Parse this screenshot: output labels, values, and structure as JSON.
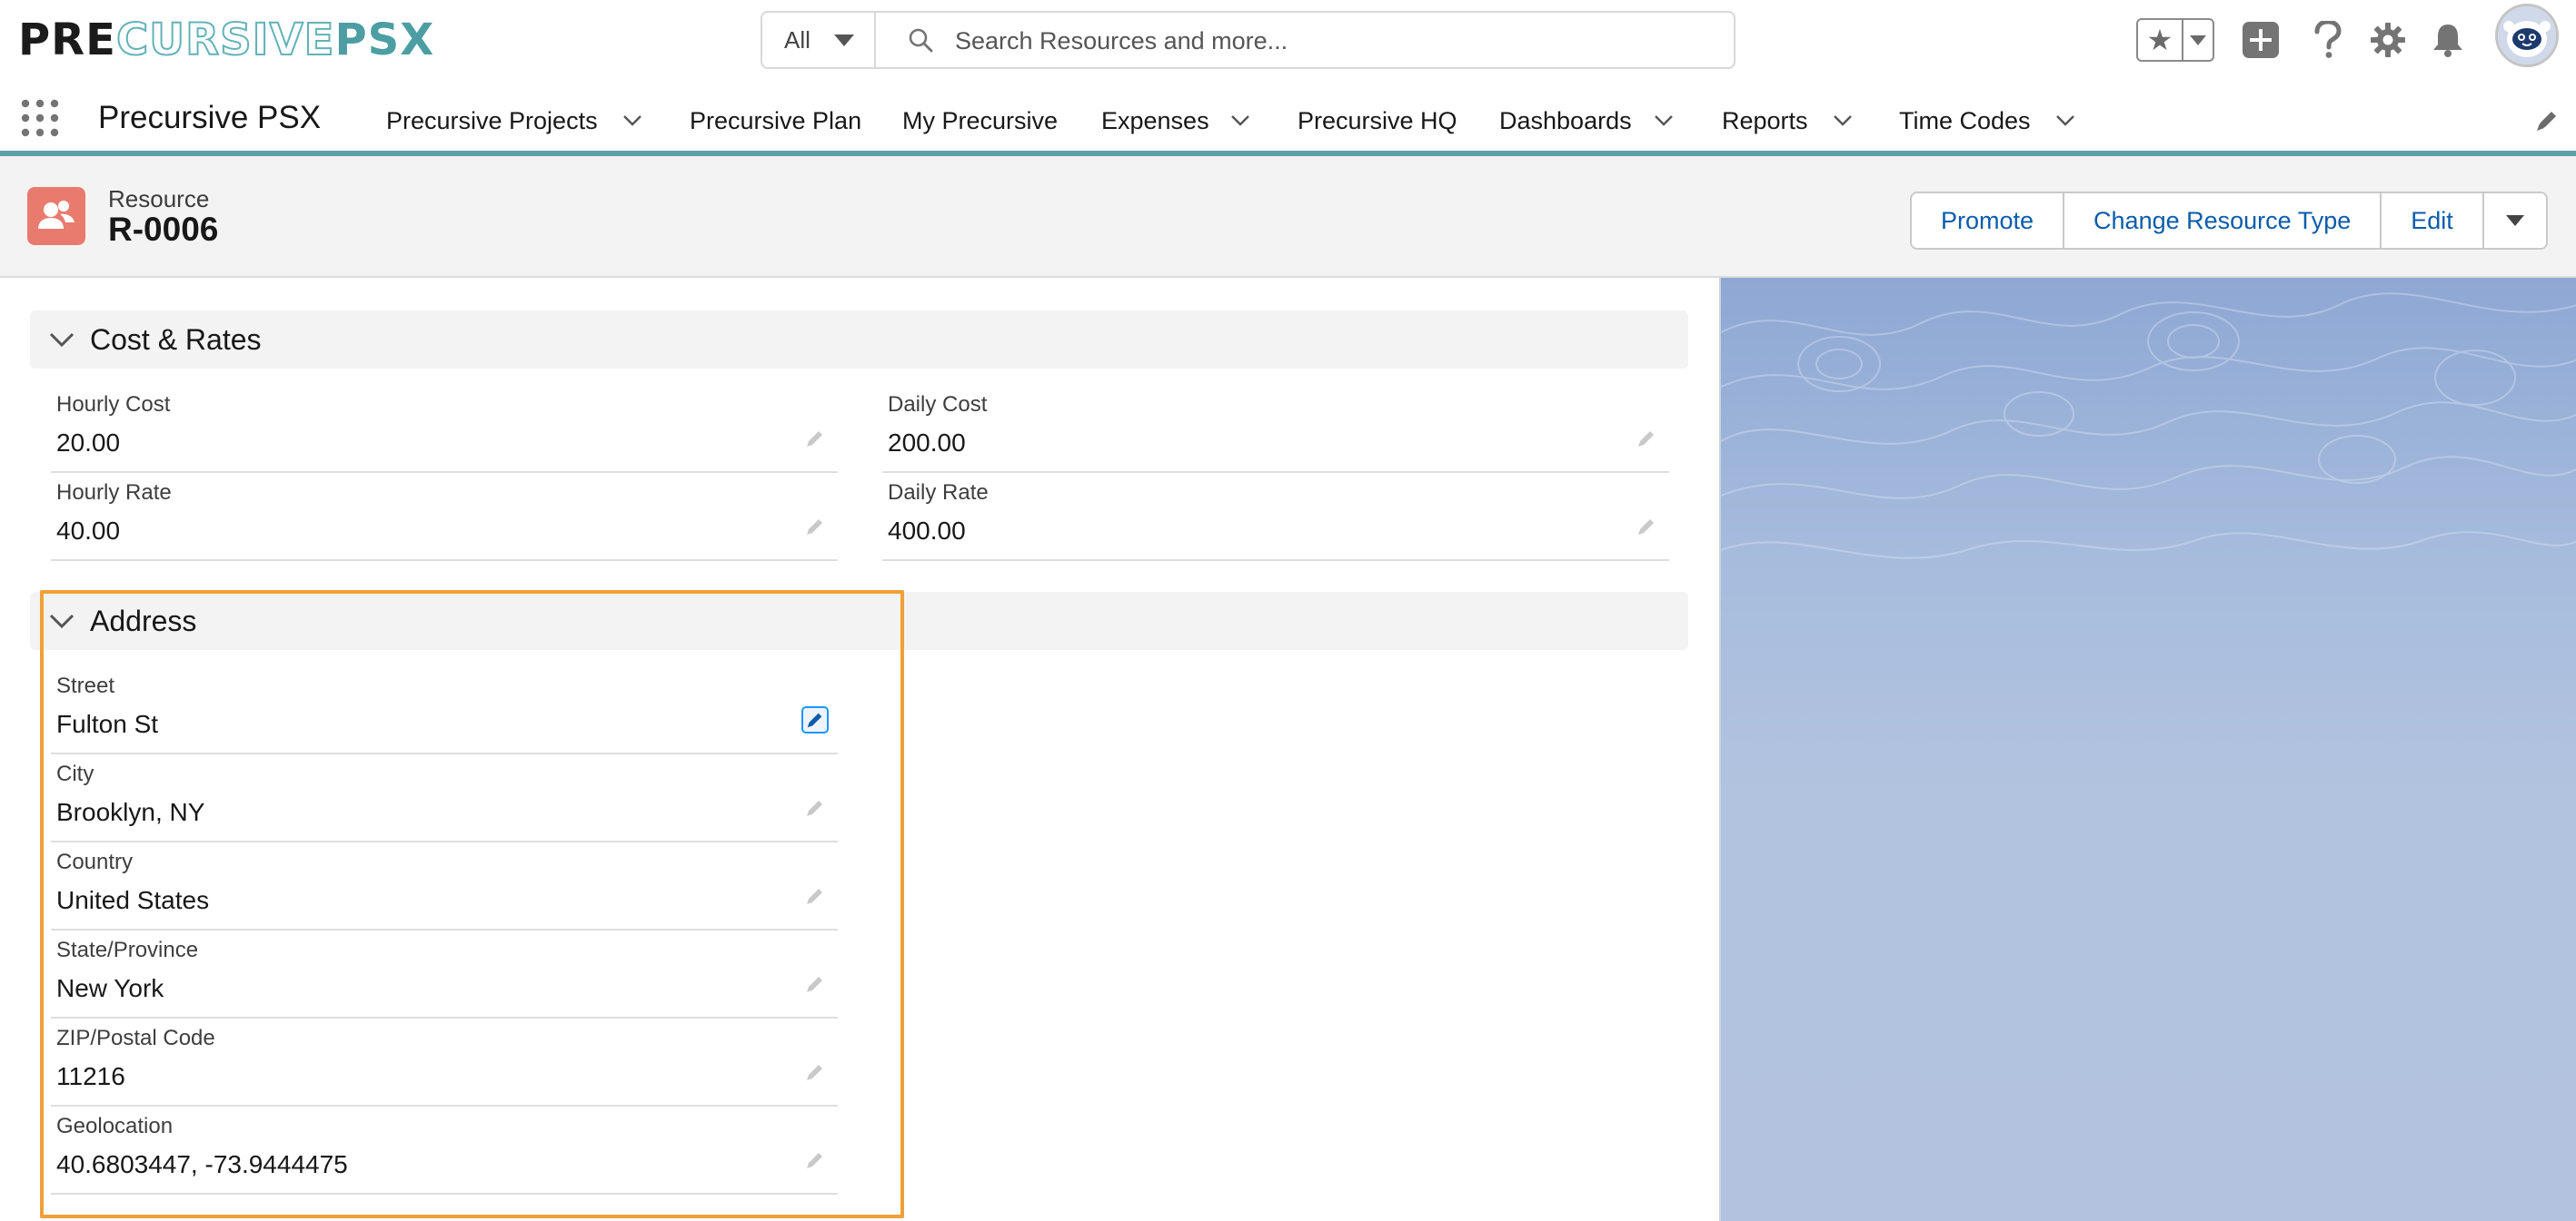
{
  "brand": {
    "logo_part1": "PRE",
    "logo_part2": "CURSIVE",
    "logo_part3": "PSX"
  },
  "search": {
    "scope": "All",
    "placeholder": "Search Resources and more..."
  },
  "nav": {
    "app_name": "Precursive PSX",
    "items": [
      {
        "label": "Precursive Projects",
        "has_menu": true
      },
      {
        "label": "Precursive Plan",
        "has_menu": false
      },
      {
        "label": "My Precursive",
        "has_menu": false
      },
      {
        "label": "Expenses",
        "has_menu": true
      },
      {
        "label": "Precursive HQ",
        "has_menu": false
      },
      {
        "label": "Dashboards",
        "has_menu": true
      },
      {
        "label": "Reports",
        "has_menu": true
      },
      {
        "label": "Time Codes",
        "has_menu": true
      }
    ]
  },
  "record": {
    "type_label": "Resource",
    "name": "R-0006",
    "actions": {
      "promote": "Promote",
      "change_type": "Change Resource Type",
      "edit": "Edit"
    }
  },
  "sections": {
    "cost_rates": {
      "title": "Cost & Rates",
      "fields": [
        {
          "label": "Hourly Cost",
          "value": "20.00"
        },
        {
          "label": "Daily Cost",
          "value": "200.00"
        },
        {
          "label": "Hourly Rate",
          "value": "40.00"
        },
        {
          "label": "Daily Rate",
          "value": "400.00"
        }
      ]
    },
    "address": {
      "title": "Address",
      "fields": [
        {
          "label": "Street",
          "value": "Fulton St"
        },
        {
          "label": "City",
          "value": "Brooklyn, NY"
        },
        {
          "label": "Country",
          "value": "United States"
        },
        {
          "label": "State/Province",
          "value": "New York"
        },
        {
          "label": "ZIP/Postal Code",
          "value": "11216"
        },
        {
          "label": "Geolocation",
          "value": "40.6803447, -73.9444475"
        }
      ]
    }
  },
  "colors": {
    "brand_teal": "#4d9ea3",
    "link_blue": "#0b5cab",
    "resource_icon": "#e97b6e",
    "highlight": "#f0a038",
    "nav_accent": "#5e9fa9"
  },
  "icons": {
    "search": "search-icon",
    "favorites": "star-icon",
    "add": "plus-icon",
    "help": "question-icon",
    "setup": "gear-icon",
    "notifications": "bell-icon",
    "launcher": "app-launcher-icon",
    "edit": "pencil-icon",
    "collapse": "chevron-down-icon",
    "record": "resource-person-icon"
  }
}
